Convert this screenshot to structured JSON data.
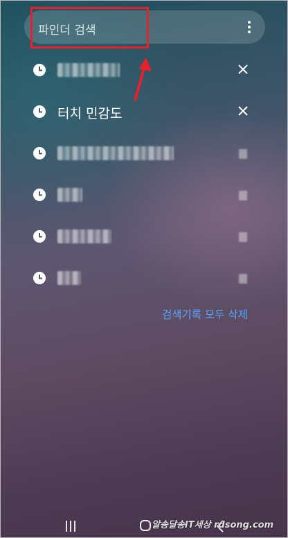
{
  "search": {
    "placeholder": "파인더 검색",
    "more_icon": "more-vert-icon"
  },
  "history": {
    "items": [
      {
        "label": "",
        "blurred": true,
        "delete_icon": "close-icon"
      },
      {
        "label": "터치 민감도",
        "blurred": false,
        "delete_icon": "close-icon"
      },
      {
        "label": "",
        "blurred": true,
        "delete_icon": "close-icon"
      },
      {
        "label": "",
        "blurred": true,
        "delete_icon": "close-icon"
      },
      {
        "label": "",
        "blurred": true,
        "delete_icon": "close-icon"
      },
      {
        "label": "",
        "blurred": true,
        "delete_icon": "close-icon"
      }
    ],
    "item_icon": "clock-icon",
    "clear_all_label": "검색기록 모두 삭제"
  },
  "colors": {
    "highlight": "#e8202a",
    "link": "#5aa7ff"
  },
  "navbar": {
    "recent_icon": "recent-apps-icon",
    "home_icon": "home-icon",
    "back_icon": "back-icon"
  },
  "watermark": {
    "text": "알송달송IT세상 rdsong.com"
  }
}
